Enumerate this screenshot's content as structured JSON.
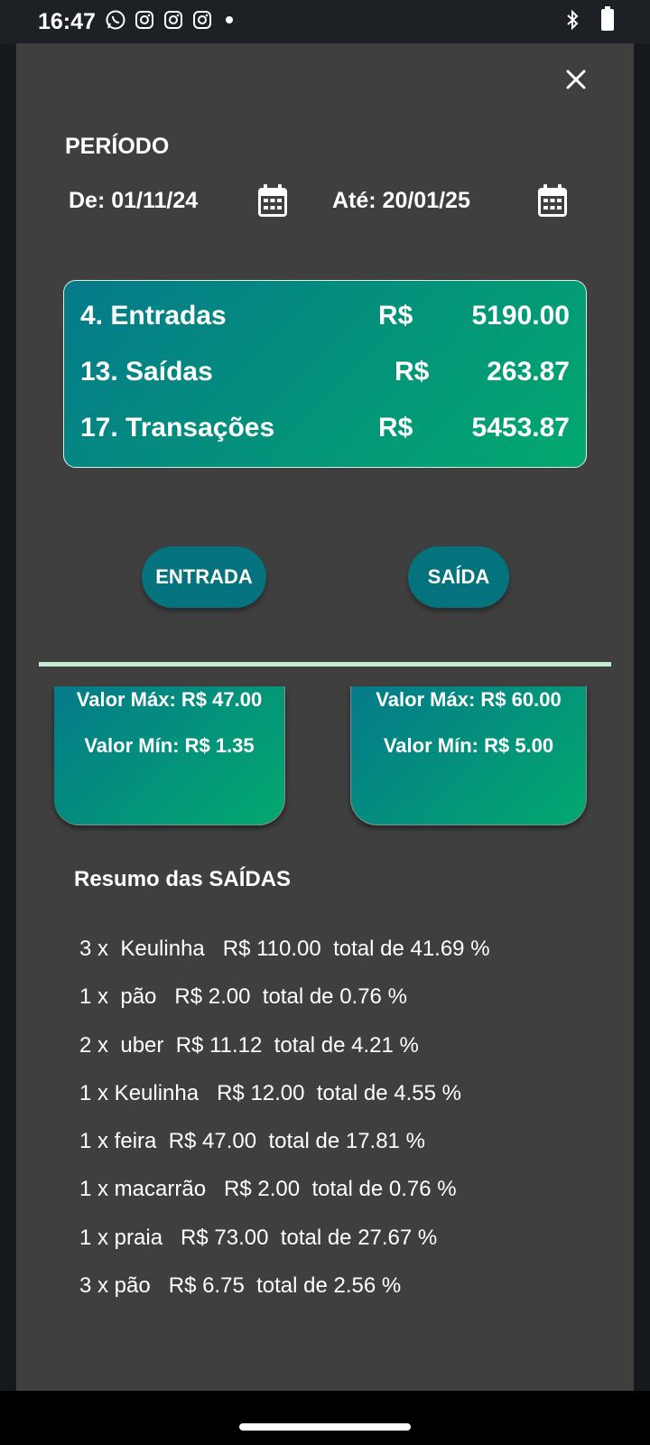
{
  "status_bar": {
    "time": "16:47"
  },
  "dialog": {
    "periodo_label": "PERÍODO",
    "date_from": "De: 01/11/24",
    "date_to": "Até: 20/01/25"
  },
  "summary": {
    "rows": [
      {
        "label": "4. Entradas",
        "currency": "R$",
        "value": "5190.00"
      },
      {
        "label": "13. Saídas",
        "currency": "R$",
        "value": "263.87"
      },
      {
        "label": "17. Transações",
        "currency": "R$",
        "value": "5453.87"
      }
    ]
  },
  "buttons": {
    "entrada": "ENTRADA",
    "saida": "SAÍDA"
  },
  "stat_cards": [
    {
      "max": "Valor Máx: R$ 47.00",
      "min": "Valor Mín: R$ 1.35"
    },
    {
      "max": "Valor Máx: R$ 60.00",
      "min": "Valor Mín: R$ 5.00"
    }
  ],
  "resumo": {
    "title": "Resumo das SAÍDAS",
    "items": [
      "3 x  Keulinha   R$ 110.00  total de 41.69 %",
      "1 x  pão   R$ 2.00  total de 0.76 %",
      "2 x  uber  R$ 11.12  total de 4.21 %",
      "1 x Keulinha   R$ 12.00  total de 4.55 %",
      "1 x feira  R$ 47.00  total de 17.81 %",
      "1 x macarrão   R$ 2.00  total de 0.76 %",
      "1 x praia   R$ 73.00  total de 27.67 %",
      "3 x pão   R$ 6.75  total de 2.56 %"
    ]
  },
  "colors": {
    "dialog_bg": "#3f3f3f",
    "gradient_start": "#057a8a",
    "gradient_end": "#02a86e",
    "button_bg": "#05737e",
    "divider": "#c8ead0"
  },
  "icons": {
    "status": [
      "whatsapp-icon",
      "instagram-icon",
      "instagram-icon",
      "instagram-icon",
      "bluetooth-icon",
      "battery-icon"
    ],
    "close": "close-icon",
    "calendar": "calendar-icon"
  }
}
